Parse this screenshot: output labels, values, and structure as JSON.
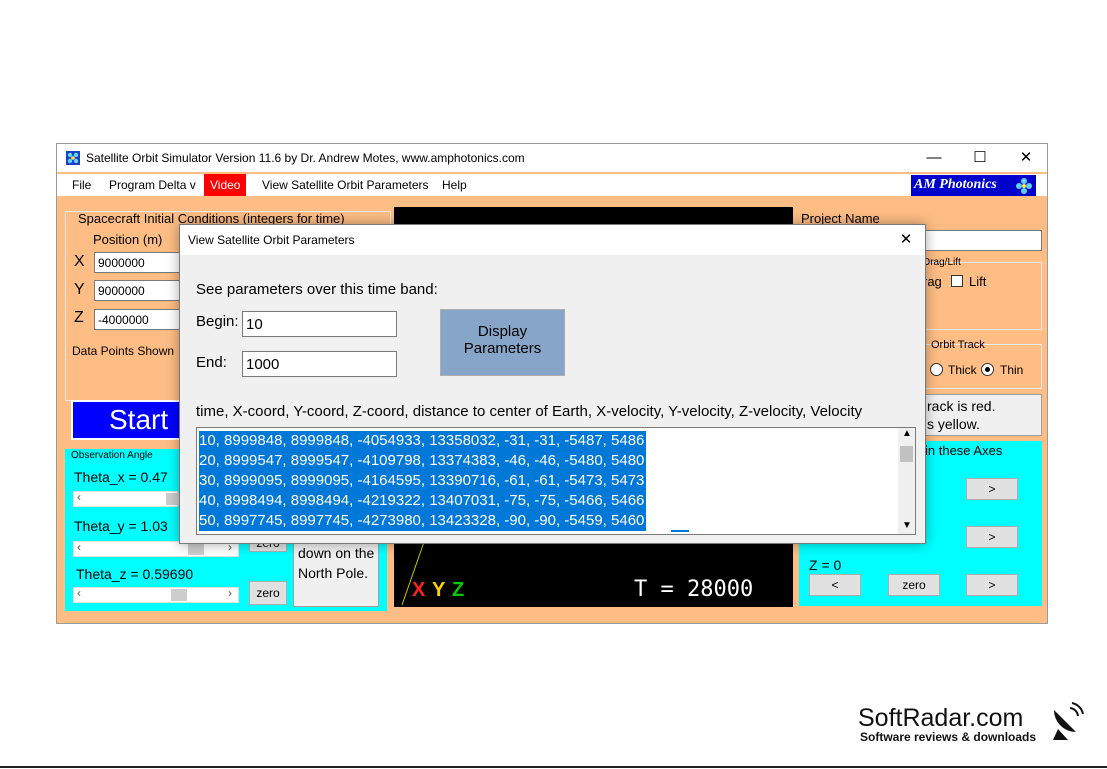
{
  "app": {
    "title": "Satellite Orbit Simulator Version 11.6 by Dr. Andrew Motes, www.amphotonics.com",
    "min": "—",
    "max": "☐",
    "close": "✕"
  },
  "menu": {
    "file": "File",
    "program": "Program Delta v",
    "video": "Video",
    "view": "View Satellite Orbit Parameters",
    "help": "Help"
  },
  "brand": {
    "label": "AM Photonics"
  },
  "left": {
    "section_title": "Spacecraft Initial Conditions (integers for time)",
    "position_label": "Position (m)",
    "x_label": "X",
    "x_value": "9000000",
    "y_label": "Y",
    "y_value": "9000000",
    "z_label": "Z",
    "z_value": "-4000000",
    "data_points": "Data Points Shown",
    "start": "Start"
  },
  "obs": {
    "title": "Observation Angle",
    "theta_x": "Theta_x = 0.47",
    "theta_y": "Theta_y = 1.03",
    "theta_z": "Theta_z = 0.59690",
    "zero": "zero",
    "note": "down on the North Pole."
  },
  "canvas": {
    "axis_x": "X",
    "axis_y": "Y",
    "axis_z": "Z",
    "time": "T = 28000"
  },
  "right": {
    "project_label": "Project Name",
    "drag_group": "Drag/Lift",
    "drag": "rag",
    "lift": "Lift",
    "orbit_group": "Orbit Track",
    "thick": "Thick",
    "thin": "Thin",
    "info_line1": "rack is red.",
    "info_line2": "s yellow.",
    "axes_title": "in these Axes",
    "z_readout": "Z = 0",
    "left_arrow": "<",
    "right_arrow": ">",
    "zero": "zero"
  },
  "dialog": {
    "title": "View Satellite Orbit Parameters",
    "close": "✕",
    "intro": "See parameters over this time band:",
    "begin_label": "Begin:",
    "begin_value": "10",
    "end_label": "End:",
    "end_value": "1000",
    "display_btn_line1": "Display",
    "display_btn_line2": "Parameters",
    "header": "time, X-coord, Y-coord, Z-coord, distance to center of Earth, X-velocity, Y-velocity, Z-velocity, Velocity",
    "rows": [
      "10, 8999848, 8999848, -4054933, 13358032, -31, -31, -5487, 5486",
      "20, 8999547, 8999547, -4109798, 13374383, -46, -46, -5480, 5480",
      "30, 8999095, 8999095, -4164595, 13390716, -61, -61, -5473, 5473",
      "40, 8998494, 8998494, -4219322, 13407031, -75, -75, -5466, 5466",
      "50, 8997745, 8997745, -4273980, 13423328, -90, -90, -5459, 5460"
    ]
  },
  "watermark": {
    "name": "SoftRadar.com",
    "tagline": "Software reviews & downloads"
  }
}
